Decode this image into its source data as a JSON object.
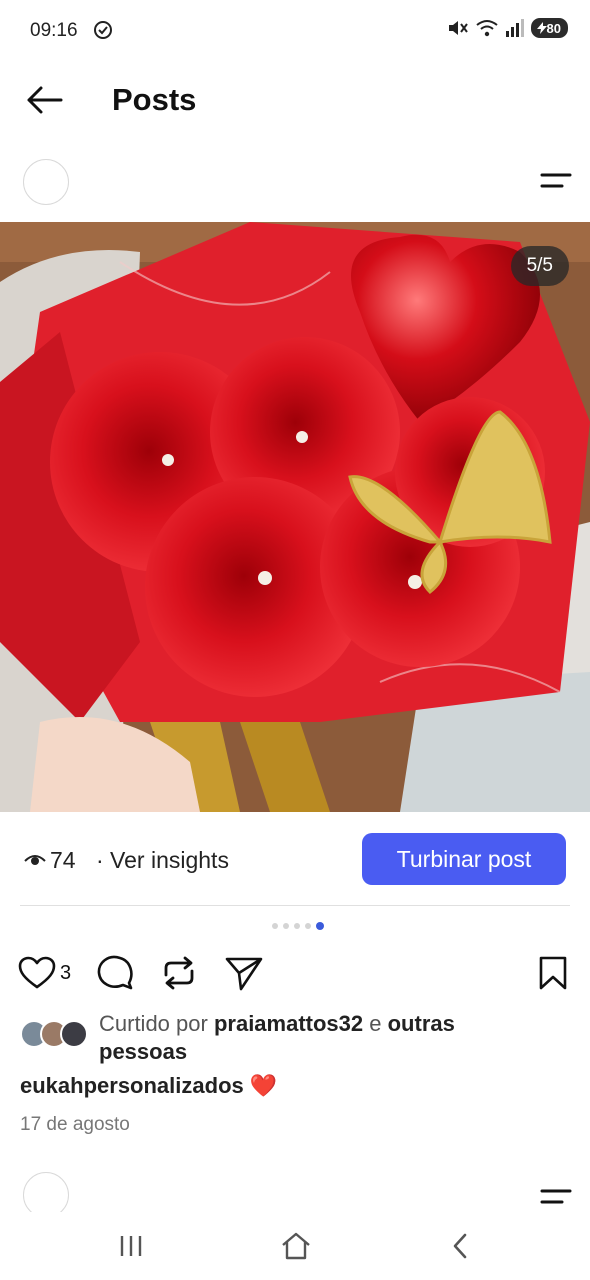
{
  "status_bar": {
    "time": "09:16",
    "battery": "80"
  },
  "header": {
    "title": "Posts"
  },
  "post": {
    "image_counter": "5/5",
    "views": "74",
    "insights_link": "· Ver insights",
    "boost_button": "Turbinar post",
    "carousel": {
      "total": 5,
      "active_index": 4
    },
    "like_count": "3",
    "likes": {
      "prefix": "Curtido por ",
      "user": "praiamattos32",
      "connector": " e ",
      "others": "outras",
      "suffix": "pessoas"
    },
    "caption": {
      "username": "eukahpersonalizados",
      "emoji": "❤️"
    },
    "date": "17 de agosto"
  },
  "colors": {
    "accent": "#4a5cf2",
    "active_dot": "#3b5bdb",
    "heart_emoji": "#e8345a"
  },
  "icons": [
    "sync-icon",
    "mute-icon",
    "wifi-icon",
    "signal-icon",
    "back-arrow-icon",
    "menu-icon",
    "eye-icon",
    "heart-icon",
    "comment-icon",
    "repost-icon",
    "share-icon",
    "bookmark-icon",
    "recents-icon",
    "home-icon",
    "nav-back-icon"
  ]
}
